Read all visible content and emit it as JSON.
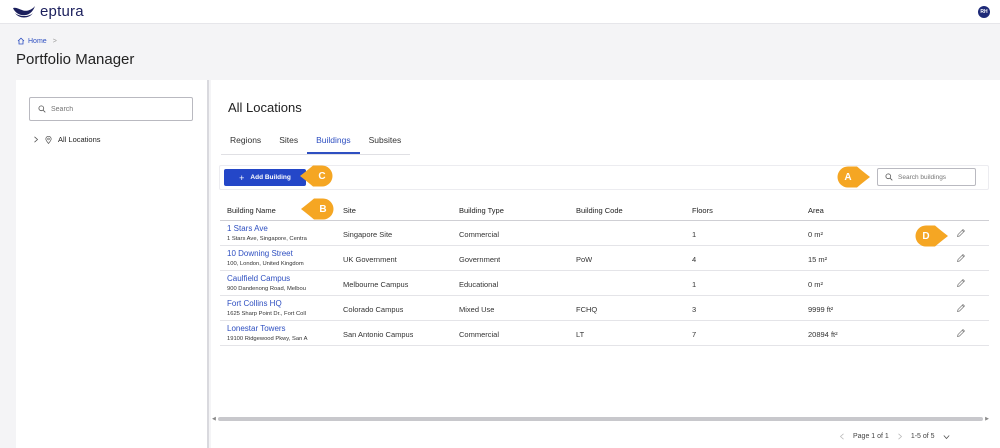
{
  "app": {
    "logo_text": "eptura",
    "user_initials": "RH",
    "brand_color": "#1b1f5c",
    "accent_color": "#2447c8",
    "callout_color": "#f5a623"
  },
  "header": {
    "breadcrumb_home": "Home",
    "breadcrumb_sep": ">",
    "title": "Portfolio Manager"
  },
  "sidebar": {
    "search_placeholder": "Search",
    "tree_label": "All Locations"
  },
  "main": {
    "title": "All Locations",
    "tabs": [
      {
        "label": "Regions",
        "active": false
      },
      {
        "label": "Sites",
        "active": false
      },
      {
        "label": "Buildings",
        "active": true
      },
      {
        "label": "Subsites",
        "active": false
      }
    ],
    "add_button": "Add Building",
    "search_placeholder": "Search buildings"
  },
  "table": {
    "headers": [
      "Building Name",
      "Site",
      "Building Type",
      "Building Code",
      "Floors",
      "Area"
    ],
    "rows": [
      {
        "name": "1 Stars Ave",
        "address": "1 Stars Ave, Singapore, Centra",
        "site": "Singapore Site",
        "type": "Commercial",
        "code": "",
        "floors": "1",
        "area": "0 m²"
      },
      {
        "name": "10 Downing Street",
        "address": "100, London, United Kingdom",
        "site": "UK Government",
        "type": "Government",
        "code": "PoW",
        "floors": "4",
        "area": "15 m²"
      },
      {
        "name": "Caulfield Campus",
        "address": "900 Dandenong Road, Melbou",
        "site": "Melbourne Campus",
        "type": "Educational",
        "code": "",
        "floors": "1",
        "area": "0 m²"
      },
      {
        "name": "Fort Collins HQ",
        "address": "1625 Sharp Point Dr., Fort Coll",
        "site": "Colorado Campus",
        "type": "Mixed Use",
        "code": "FCHQ",
        "floors": "3",
        "area": "9999 ft²"
      },
      {
        "name": "Lonestar Towers",
        "address": "19100 Ridgewood Pkwy, San A",
        "site": "San Antonio Campus",
        "type": "Commercial",
        "code": "LT",
        "floors": "7",
        "area": "20894 ft²"
      }
    ]
  },
  "pager": {
    "page_text": "Page 1 of 1",
    "range_text": "1-5 of 5"
  },
  "callouts": {
    "a": "A",
    "b": "B",
    "c": "C",
    "d": "D"
  },
  "icons": {
    "logo": "eptura-logo-icon",
    "home": "home-icon",
    "search": "search-icon",
    "chevron_right": "chevron-right-icon",
    "location_pin": "location-pin-icon",
    "plus": "plus-icon",
    "edit": "pencil-edit-icon",
    "chevron_left": "chevron-left-icon",
    "chevron_down": "chevron-down-icon"
  }
}
